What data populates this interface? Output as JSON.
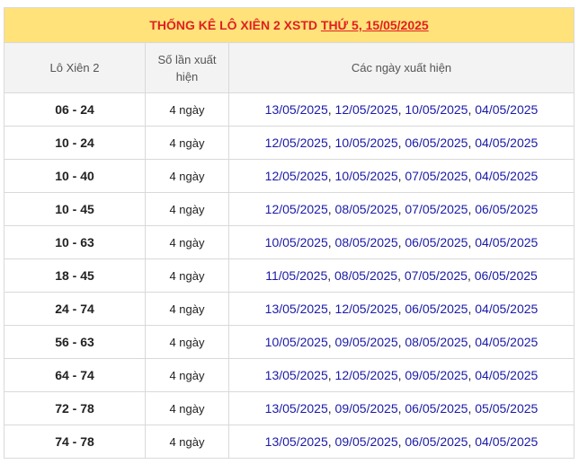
{
  "title": {
    "prefix": "THỐNG KÊ LÔ XIÊN 2 XSTD ",
    "link": "THỨ 5, 15/05/2025"
  },
  "headers": {
    "col1": "Lô Xiên 2",
    "col2": "Số lần xuất hiện",
    "col3": "Các ngày xuất hiện"
  },
  "rows": [
    {
      "pair": "06 - 24",
      "count": "4 ngày",
      "dates": [
        "13/05/2025",
        "12/05/2025",
        "10/05/2025",
        "04/05/2025"
      ]
    },
    {
      "pair": "10 - 24",
      "count": "4 ngày",
      "dates": [
        "12/05/2025",
        "10/05/2025",
        "06/05/2025",
        "04/05/2025"
      ]
    },
    {
      "pair": "10 - 40",
      "count": "4 ngày",
      "dates": [
        "12/05/2025",
        "10/05/2025",
        "07/05/2025",
        "04/05/2025"
      ]
    },
    {
      "pair": "10 - 45",
      "count": "4 ngày",
      "dates": [
        "12/05/2025",
        "08/05/2025",
        "07/05/2025",
        "06/05/2025"
      ]
    },
    {
      "pair": "10 - 63",
      "count": "4 ngày",
      "dates": [
        "10/05/2025",
        "08/05/2025",
        "06/05/2025",
        "04/05/2025"
      ]
    },
    {
      "pair": "18 - 45",
      "count": "4 ngày",
      "dates": [
        "11/05/2025",
        "08/05/2025",
        "07/05/2025",
        "06/05/2025"
      ]
    },
    {
      "pair": "24 - 74",
      "count": "4 ngày",
      "dates": [
        "13/05/2025",
        "12/05/2025",
        "06/05/2025",
        "04/05/2025"
      ]
    },
    {
      "pair": "56 - 63",
      "count": "4 ngày",
      "dates": [
        "10/05/2025",
        "09/05/2025",
        "08/05/2025",
        "04/05/2025"
      ]
    },
    {
      "pair": "64 - 74",
      "count": "4 ngày",
      "dates": [
        "13/05/2025",
        "12/05/2025",
        "09/05/2025",
        "04/05/2025"
      ]
    },
    {
      "pair": "72 - 78",
      "count": "4 ngày",
      "dates": [
        "13/05/2025",
        "09/05/2025",
        "06/05/2025",
        "05/05/2025"
      ]
    },
    {
      "pair": "74 - 78",
      "count": "4 ngày",
      "dates": [
        "13/05/2025",
        "09/05/2025",
        "06/05/2025",
        "04/05/2025"
      ]
    }
  ],
  "colors": {
    "title_bg": "#ffe27a",
    "title_text": "#e02020",
    "date_text": "#1a1aa6"
  }
}
